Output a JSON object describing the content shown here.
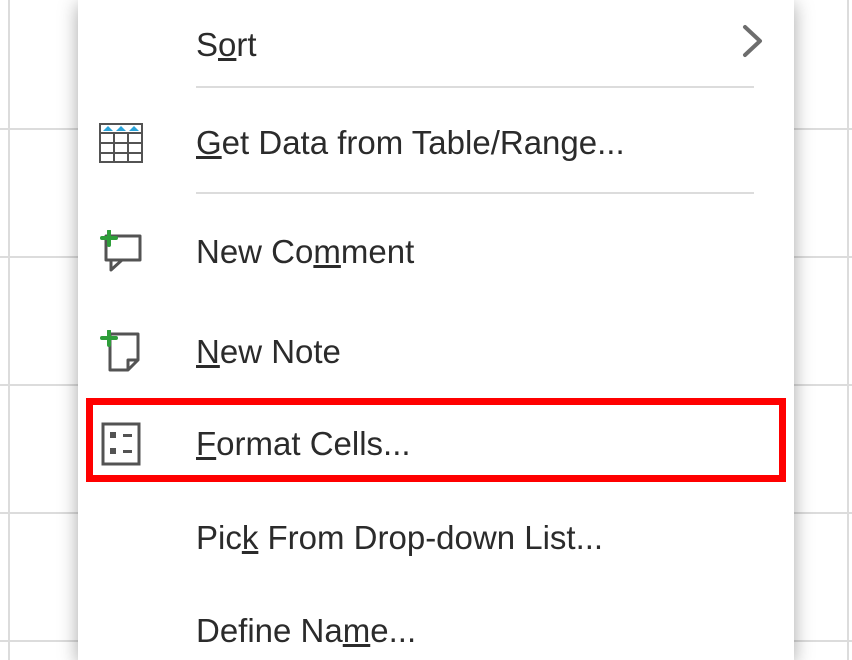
{
  "menu": {
    "sort_label": "Sort",
    "get_data_label": "Get Data from Table/Range...",
    "new_comment_label": "New Comment",
    "new_note_label": "New Note",
    "format_cells_label": "Format Cells...",
    "pick_list_label": "Pick From Drop-down List...",
    "define_name_label": "Define Name...",
    "mnemonics": {
      "sort": 1,
      "get_data": 0,
      "new_comment": 6,
      "new_note": 0,
      "format_cells": 0,
      "pick_list": 3,
      "define_name": 9
    }
  }
}
